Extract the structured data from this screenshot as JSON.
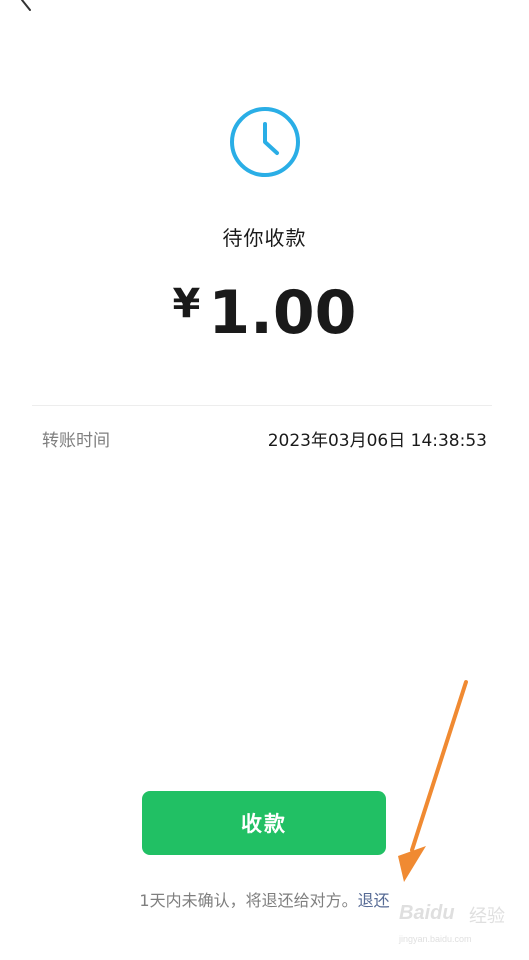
{
  "status": {
    "title": "待你收款"
  },
  "amount": {
    "currency_symbol": "¥",
    "value": "1.00"
  },
  "details": [
    {
      "label": "转账时间",
      "value": "2023年03月06日 14:38:53"
    }
  ],
  "actions": {
    "collect_label": "收款"
  },
  "footer": {
    "note": "1天内未确认，将退还给对方。",
    "refund_label": "退还"
  },
  "watermark": {
    "logo": "Baidu",
    "text": "经验",
    "url": "jingyan.baidu.com"
  },
  "colors": {
    "accent_green": "#21c064",
    "clock_blue": "#2aaee6",
    "link_blue": "#576b95",
    "annotation_orange": "#f08a32"
  },
  "icons": {
    "back": "chevron-left-icon",
    "status": "clock-icon"
  }
}
